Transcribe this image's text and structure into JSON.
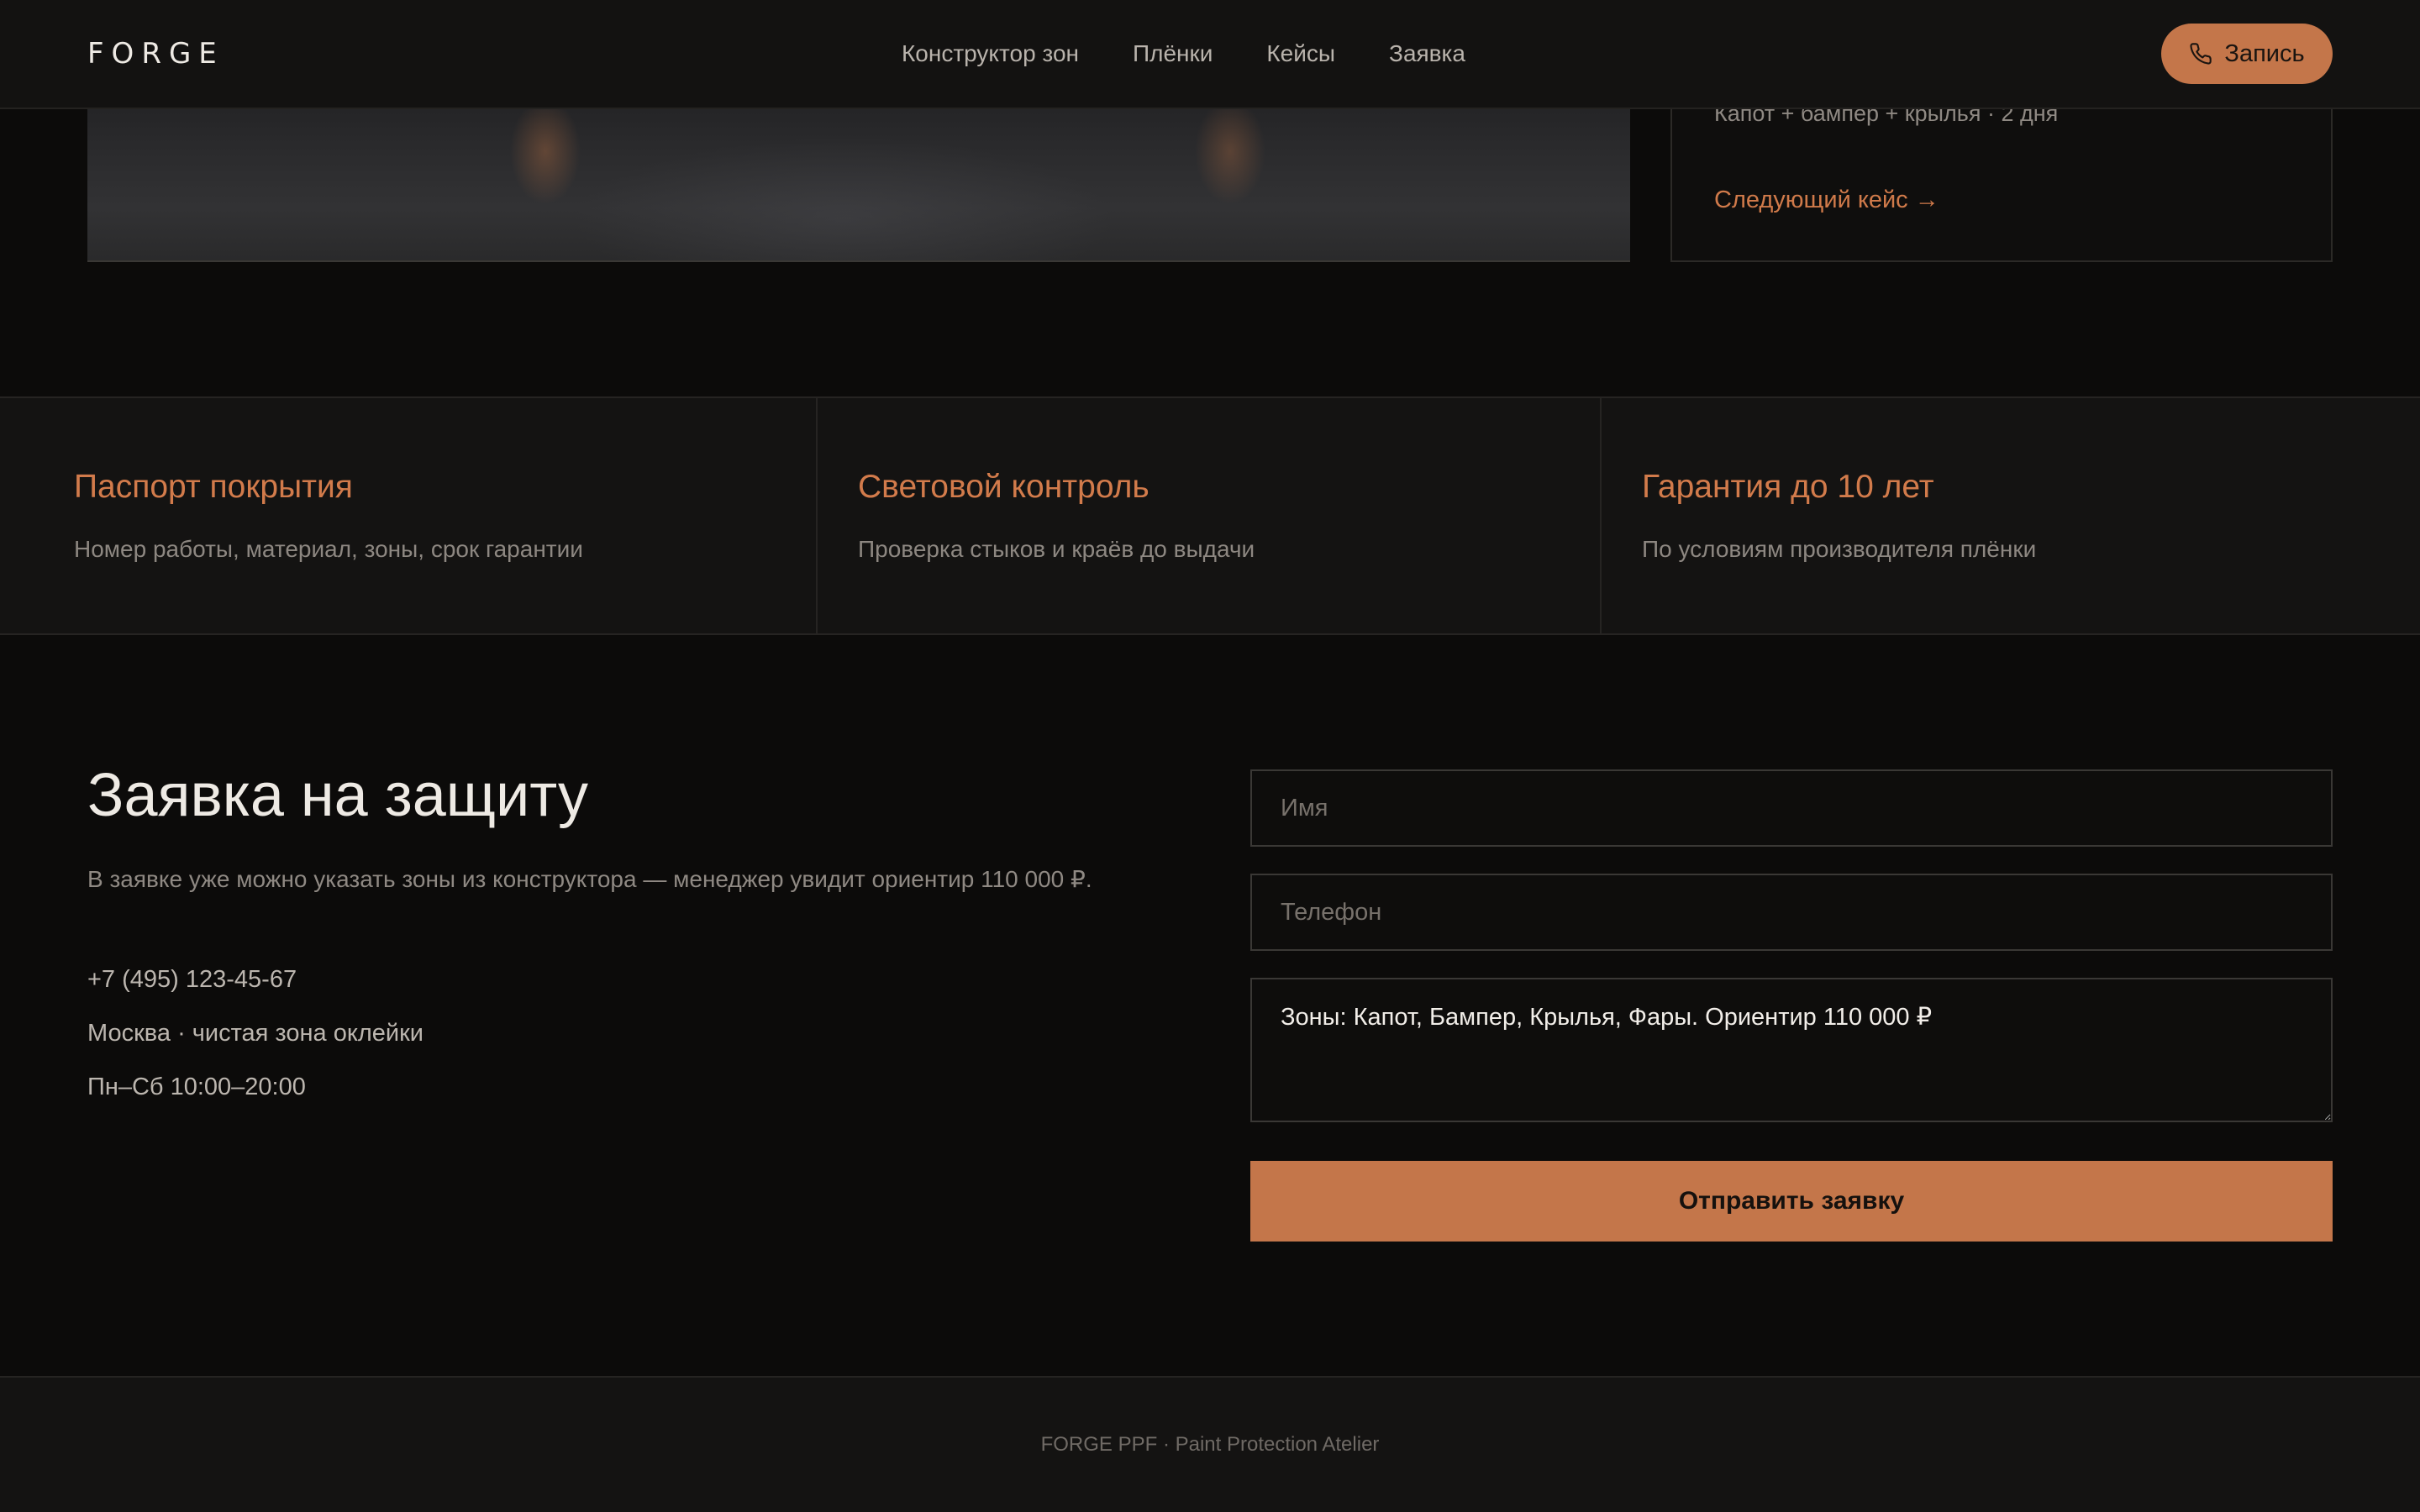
{
  "header": {
    "logo": "FORGE",
    "nav": [
      "Конструктор зон",
      "Плёнки",
      "Кейсы",
      "Заявка"
    ],
    "cta_label": "Запись",
    "cta_icon": "phone-icon"
  },
  "case": {
    "meta": "Капот + бампер + крылья · 2 дня",
    "next_link": "Следующий кейс →"
  },
  "features": [
    {
      "title": "Паспорт покрытия",
      "text": "Номер работы, материал, зоны, срок гарантии"
    },
    {
      "title": "Световой контроль",
      "text": "Проверка стыков и краёв до выдачи"
    },
    {
      "title": "Гарантия до 10 лет",
      "text": "По условиям производителя плёнки"
    }
  ],
  "request": {
    "title": "Заявка на защиту",
    "subtitle": "В заявке уже можно указать зоны из конструктора — менеджер увидит ориентир 110 000 ₽.",
    "phone": "+7 (495) 123-45-67",
    "location": "Москва · чистая зона оклейки",
    "hours": "Пн–Сб 10:00–20:00",
    "form": {
      "name_placeholder": "Имя",
      "phone_placeholder": "Телефон",
      "zones_value": "Зоны: Капот, Бампер, Крылья, Фары. Ориентир 110 000 ₽",
      "submit_label": "Отправить заявку"
    }
  },
  "footer": {
    "text": "FORGE PPF · Paint Protection Atelier"
  },
  "colors": {
    "accent": "#c4764a",
    "accent_text": "#d27b4b",
    "background": "#0c0b0a",
    "panel": "#141312"
  }
}
